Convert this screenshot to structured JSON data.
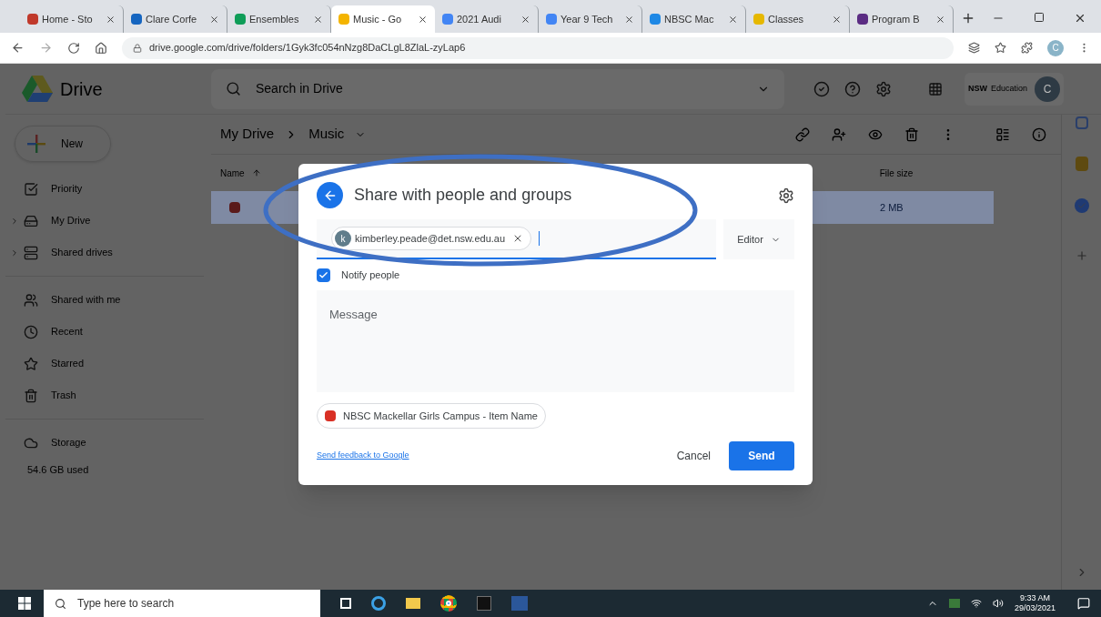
{
  "browser": {
    "tabs": [
      {
        "label": "Home - Sto",
        "color": "#c0392b",
        "selected": false
      },
      {
        "label": "Clare Corfe",
        "color": "#1565c0",
        "selected": false
      },
      {
        "label": "Ensembles",
        "color": "#0f9d58",
        "selected": false
      },
      {
        "label": "Music - Go",
        "color": "#f4b400",
        "selected": true
      },
      {
        "label": "2021 Audi",
        "color": "#4285f4",
        "selected": false
      },
      {
        "label": "Year 9 Tech",
        "color": "#4285f4",
        "selected": false
      },
      {
        "label": "NBSC Mac",
        "color": "#1e88e5",
        "selected": false
      },
      {
        "label": "Classes",
        "color": "#e6b800",
        "selected": false
      },
      {
        "label": "Program B",
        "color": "#5b2c83",
        "selected": false
      }
    ],
    "url": "drive.google.com/drive/folders/1Gyk3fc054nNzg8DaCLgL8ZlaL-zyLap6",
    "profile": "C"
  },
  "drive": {
    "app_name": "Drive",
    "search": {
      "placeholder": "Search in Drive"
    },
    "org": {
      "badge": "NSW",
      "name": "Education"
    },
    "avatar": "C",
    "new_button": "New",
    "sidebar": {
      "sections": [
        {
          "items": [
            {
              "label": "Priority",
              "kind": "priority",
              "expandable": false
            },
            {
              "label": "My Drive",
              "kind": "drive",
              "expandable": true
            },
            {
              "label": "Shared drives",
              "kind": "shared-drives",
              "expandable": true
            }
          ]
        },
        {
          "items": [
            {
              "label": "Shared with me",
              "kind": "people",
              "expandable": false
            },
            {
              "label": "Recent",
              "kind": "clock",
              "expandable": false
            },
            {
              "label": "Starred",
              "kind": "star",
              "expandable": false
            },
            {
              "label": "Trash",
              "kind": "trash",
              "expandable": false
            }
          ]
        },
        {
          "items": [
            {
              "label": "Storage",
              "kind": "cloud",
              "expandable": false
            }
          ]
        }
      ],
      "storage_used": "54.6 GB used"
    },
    "breadcrumb": [
      "My Drive",
      "Music"
    ],
    "table": {
      "columns": [
        "Name",
        "File size"
      ],
      "rows": [
        {
          "file_size": "2 MB",
          "selected": true
        }
      ]
    }
  },
  "dialog": {
    "title": "Share with people and groups",
    "recipients": [
      {
        "initial": "k",
        "email": "kimberley.peade@det.nsw.edu.au"
      }
    ],
    "role": "Editor",
    "notify": {
      "label": "Notify people",
      "checked": true
    },
    "message": {
      "placeholder": "Message"
    },
    "attachment": "NBSC Mackellar Girls Campus - Item Name",
    "feedback_link": "Send feedback to Google",
    "cancel": "Cancel",
    "send": "Send"
  },
  "taskbar": {
    "search": {
      "placeholder": "Type here to search"
    },
    "time": "9:33 AM",
    "date": "29/03/2021"
  }
}
